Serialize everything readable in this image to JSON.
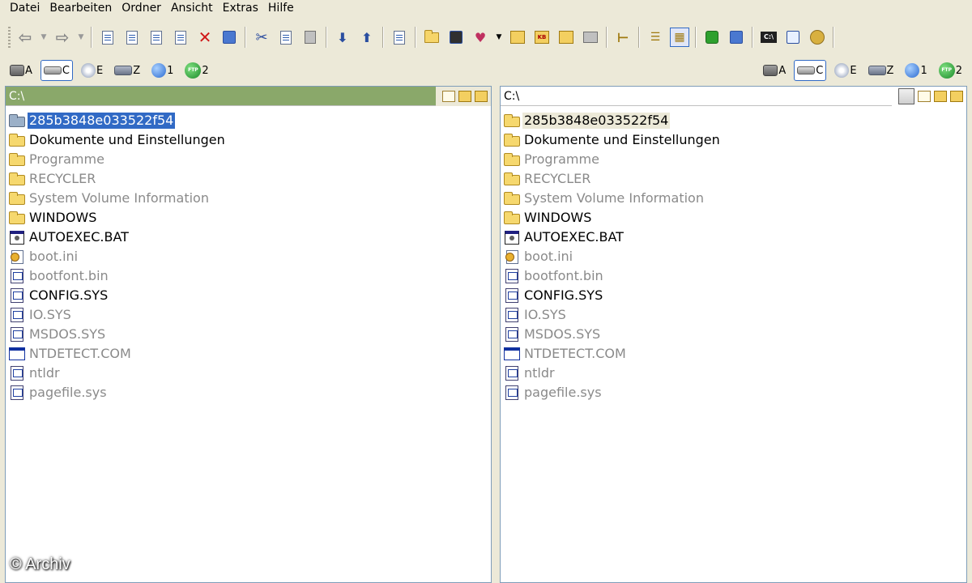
{
  "menu": [
    "Datei",
    "Bearbeiten",
    "Ordner",
    "Ansicht",
    "Extras",
    "Hilfe"
  ],
  "toolbar_icons": [
    "back-arrow-icon",
    "forward-arrow-icon",
    "search-icon",
    "edit-icon",
    "copy-file-icon",
    "move-file-icon",
    "delete-icon",
    "binoculars-icon",
    "cut-icon",
    "copy-icon",
    "paste-icon",
    "upload-icon",
    "download-icon",
    "compare-icon",
    "new-folder-icon",
    "find-icon",
    "highlight-icon",
    "special-folder-icon",
    "kb-icon",
    "folder-info-icon",
    "drive-icon",
    "tree-icon",
    "list-view-icon",
    "details-view-icon",
    "refresh-icon",
    "window-icon",
    "console-icon",
    "checklist-icon",
    "tools-icon"
  ],
  "left": {
    "drives": [
      {
        "label": "A",
        "icon": "floppy-drive-icon",
        "active": false
      },
      {
        "label": "C",
        "icon": "hard-drive-icon",
        "active": true
      },
      {
        "label": "E",
        "icon": "cd-drive-icon",
        "active": false
      },
      {
        "label": "Z",
        "icon": "network-drive-icon",
        "active": false
      },
      {
        "label": "1",
        "icon": "globe-icon",
        "active": false
      },
      {
        "label": "2",
        "icon": "ftp-icon",
        "active": false
      }
    ],
    "path": "C:\\",
    "files": [
      {
        "name": "285b3848e033522f54",
        "type": "folder",
        "hidden": false,
        "selected": true
      },
      {
        "name": "Dokumente und Einstellungen",
        "type": "folder",
        "hidden": false
      },
      {
        "name": "Programme",
        "type": "folder",
        "hidden": true
      },
      {
        "name": "RECYCLER",
        "type": "folder",
        "hidden": true
      },
      {
        "name": "System Volume Information",
        "type": "folder",
        "hidden": true
      },
      {
        "name": "WINDOWS",
        "type": "folder",
        "hidden": false
      },
      {
        "name": "AUTOEXEC.BAT",
        "type": "bat",
        "hidden": false
      },
      {
        "name": "boot.ini",
        "type": "ini",
        "hidden": true
      },
      {
        "name": "bootfont.bin",
        "type": "sys",
        "hidden": true
      },
      {
        "name": "CONFIG.SYS",
        "type": "sys",
        "hidden": false
      },
      {
        "name": "IO.SYS",
        "type": "sys",
        "hidden": true
      },
      {
        "name": "MSDOS.SYS",
        "type": "sys",
        "hidden": true
      },
      {
        "name": "NTDETECT.COM",
        "type": "com",
        "hidden": true
      },
      {
        "name": "ntldr",
        "type": "sys",
        "hidden": true
      },
      {
        "name": "pagefile.sys",
        "type": "sys",
        "hidden": true
      }
    ]
  },
  "right": {
    "drives": [
      {
        "label": "A",
        "icon": "floppy-drive-icon",
        "active": false
      },
      {
        "label": "C",
        "icon": "hard-drive-icon",
        "active": true
      },
      {
        "label": "E",
        "icon": "cd-drive-icon",
        "active": false
      },
      {
        "label": "Z",
        "icon": "network-drive-icon",
        "active": false
      },
      {
        "label": "1",
        "icon": "globe-icon",
        "active": false
      },
      {
        "label": "2",
        "icon": "ftp-icon",
        "active": false
      }
    ],
    "path": "C:\\",
    "files": [
      {
        "name": "285b3848e033522f54",
        "type": "folder",
        "hidden": false,
        "focused": true
      },
      {
        "name": "Dokumente und Einstellungen",
        "type": "folder",
        "hidden": false
      },
      {
        "name": "Programme",
        "type": "folder",
        "hidden": true
      },
      {
        "name": "RECYCLER",
        "type": "folder",
        "hidden": true
      },
      {
        "name": "System Volume Information",
        "type": "folder",
        "hidden": true
      },
      {
        "name": "WINDOWS",
        "type": "folder",
        "hidden": false
      },
      {
        "name": "AUTOEXEC.BAT",
        "type": "bat",
        "hidden": false
      },
      {
        "name": "boot.ini",
        "type": "ini",
        "hidden": true
      },
      {
        "name": "bootfont.bin",
        "type": "sys",
        "hidden": true
      },
      {
        "name": "CONFIG.SYS",
        "type": "sys",
        "hidden": false
      },
      {
        "name": "IO.SYS",
        "type": "sys",
        "hidden": true
      },
      {
        "name": "MSDOS.SYS",
        "type": "sys",
        "hidden": true
      },
      {
        "name": "NTDETECT.COM",
        "type": "com",
        "hidden": true
      },
      {
        "name": "ntldr",
        "type": "sys",
        "hidden": true
      },
      {
        "name": "pagefile.sys",
        "type": "sys",
        "hidden": true
      }
    ]
  },
  "watermark": "© Archiv",
  "colors": {
    "left_path_bar": "#8aa86a",
    "selection": "#316ac5",
    "hidden_text": "#8a8a8a",
    "window_bg": "#ece9d8"
  }
}
